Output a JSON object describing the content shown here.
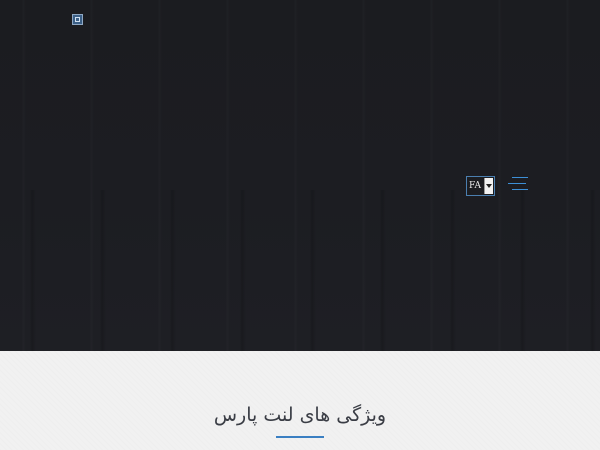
{
  "header": {
    "broken_image_icon": "broken-image-icon",
    "language_select": {
      "selected": "FA",
      "border_color": "#4b7fb0"
    },
    "menu_icon": "hamburger-menu-icon",
    "accent_color": "#3d8fd6",
    "background_color": "#1c1d21"
  },
  "features": {
    "title": "ویژگی های لنت پارس",
    "underline_color": "#3a7fc2",
    "background_color": "#f1f1f1"
  }
}
